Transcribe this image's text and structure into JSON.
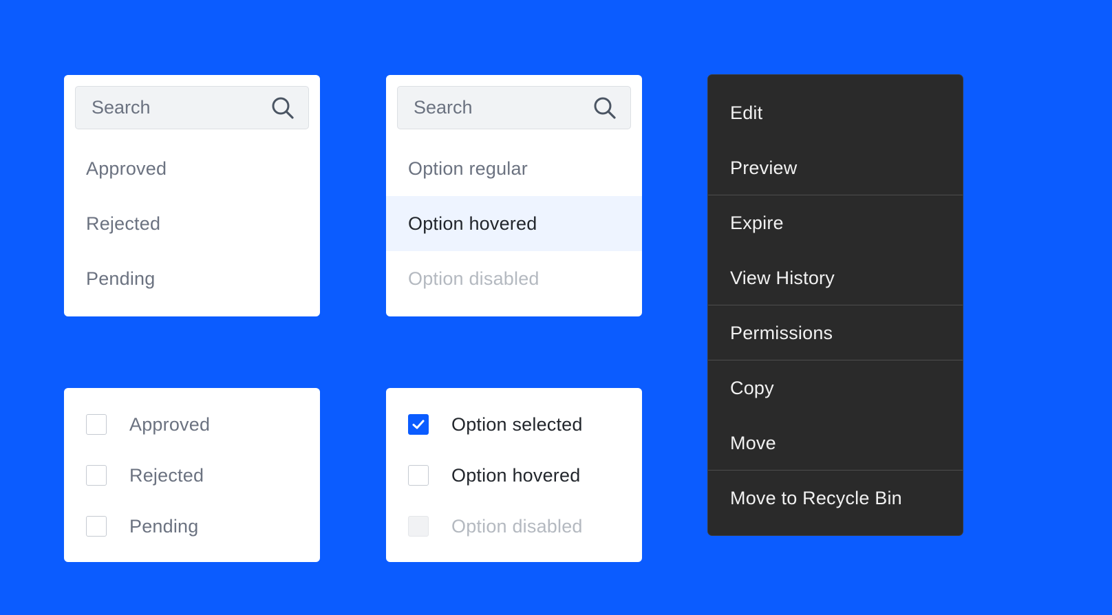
{
  "colors": {
    "background": "#0b5cff",
    "accent": "#0b5cff",
    "hover": "#eef4ff",
    "menu_background": "#2a2a2a"
  },
  "dropdown_default": {
    "search": {
      "placeholder": "Search",
      "icon": "search-icon"
    },
    "options": [
      {
        "label": "Approved",
        "state": "default"
      },
      {
        "label": "Rejected",
        "state": "default"
      },
      {
        "label": "Pending",
        "state": "default"
      }
    ]
  },
  "dropdown_states": {
    "search": {
      "placeholder": "Search",
      "icon": "search-icon"
    },
    "options": [
      {
        "label": "Option regular",
        "state": "regular"
      },
      {
        "label": "Option hovered",
        "state": "hovered"
      },
      {
        "label": "Option disabled",
        "state": "disabled"
      }
    ]
  },
  "checklist_default": {
    "options": [
      {
        "label": "Approved",
        "checked": false
      },
      {
        "label": "Rejected",
        "checked": false
      },
      {
        "label": "Pending",
        "checked": false
      }
    ]
  },
  "checklist_states": {
    "options": [
      {
        "label": "Option selected",
        "checked": true,
        "state": "selected"
      },
      {
        "label": "Option hovered",
        "checked": false,
        "state": "hovered"
      },
      {
        "label": "Option disabled",
        "checked": false,
        "state": "disabled"
      }
    ]
  },
  "context_menu": {
    "items": [
      {
        "label": "Edit"
      },
      {
        "label": "Preview"
      },
      {
        "label": "Expire"
      },
      {
        "label": "View History"
      },
      {
        "label": "Permissions"
      },
      {
        "label": "Copy"
      },
      {
        "label": "Move"
      },
      {
        "label": "Move to Recycle Bin"
      }
    ]
  }
}
